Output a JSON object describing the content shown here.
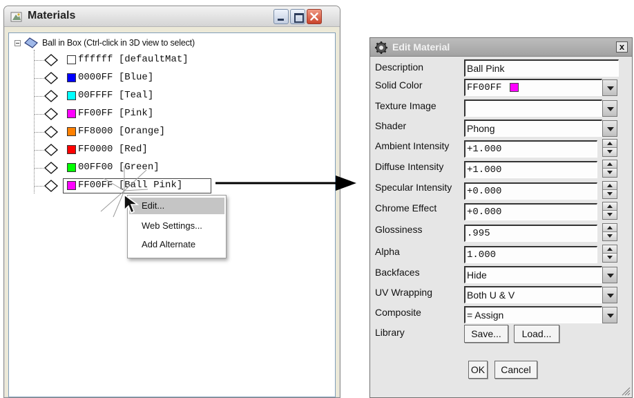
{
  "materials_window": {
    "title": "Materials",
    "root_label": "Ball in Box (Ctrl-click in 3D view to select)",
    "items": [
      {
        "code": "ffffff",
        "name": "[defaultMat]",
        "color": "#ffffff"
      },
      {
        "code": "0000FF",
        "name": "[Blue]",
        "color": "#0000ff"
      },
      {
        "code": "00FFFF",
        "name": "[Teal]",
        "color": "#00ffff"
      },
      {
        "code": "FF00FF",
        "name": "[Pink]",
        "color": "#ff00ff"
      },
      {
        "code": "FF8000",
        "name": "[Orange]",
        "color": "#ff8000"
      },
      {
        "code": "FF0000",
        "name": "[Red]",
        "color": "#ff0000"
      },
      {
        "code": "00FF00",
        "name": "[Green]",
        "color": "#00ff00"
      },
      {
        "code": "FF00FF",
        "name": "[Ball Pink]",
        "color": "#ff00ff"
      }
    ]
  },
  "context_menu": {
    "items": [
      "Edit...",
      "Web Settings...",
      "Add Alternate"
    ]
  },
  "edit_material": {
    "title": "Edit Material",
    "close_label": "x",
    "fields": {
      "description": {
        "label": "Description",
        "value": "Ball Pink"
      },
      "solid_color": {
        "label": "Solid Color",
        "value": "FF00FF",
        "swatch": "#ff00ff"
      },
      "texture_image": {
        "label": "Texture Image",
        "value": ""
      },
      "shader": {
        "label": "Shader",
        "value": "Phong"
      },
      "ambient": {
        "label": "Ambient Intensity",
        "value": "+1.000"
      },
      "diffuse": {
        "label": "Diffuse Intensity",
        "value": "+1.000"
      },
      "specular": {
        "label": "Specular Intensity",
        "value": "+0.000"
      },
      "chrome": {
        "label": "Chrome Effect",
        "value": "+0.000"
      },
      "glossiness": {
        "label": "Glossiness",
        "value": ".995"
      },
      "alpha": {
        "label": "Alpha",
        "value": "1.000"
      },
      "backfaces": {
        "label": "Backfaces",
        "value": "Hide"
      },
      "uv_wrapping": {
        "label": "UV Wrapping",
        "value": "Both U & V"
      },
      "composite": {
        "label": "Composite",
        "value": "= Assign"
      },
      "library": {
        "label": "Library"
      }
    },
    "buttons": {
      "save": "Save...",
      "load": "Load...",
      "ok": "OK",
      "cancel": "Cancel"
    }
  }
}
